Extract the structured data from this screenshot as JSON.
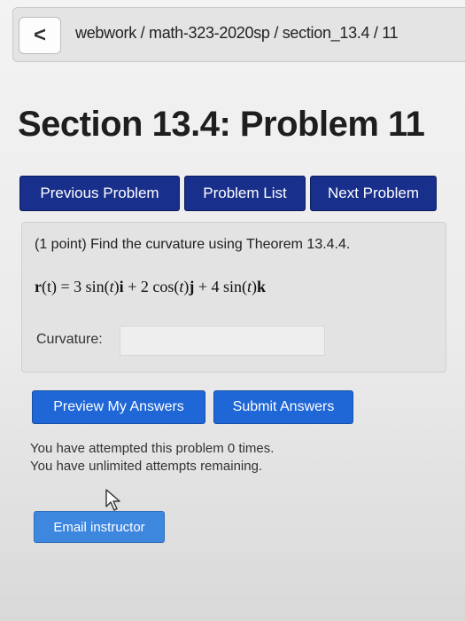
{
  "header": {
    "back_label": "<",
    "breadcrumb": "webwork / math-323-2020sp / section_13.4 / 11"
  },
  "page_title": "Section 13.4: Problem 11",
  "nav": {
    "previous": "Previous Problem",
    "list": "Problem List",
    "next": "Next Problem"
  },
  "problem": {
    "statement": "(1 point) Find the curvature using Theorem 13.4.4.",
    "formula": {
      "lhs_vec": "r",
      "lhs_arg": "(t)",
      "eq": " = 3 sin(",
      "t1": "t",
      "p1": ")",
      "i": "i",
      "p2": " + 2 cos(",
      "t2": "t",
      "p3": ")",
      "j": "j",
      "p4": " + 4 sin(",
      "t3": "t",
      "p5": ")",
      "k": "k"
    },
    "answer_label": "Curvature:",
    "answer_value": ""
  },
  "actions": {
    "preview": "Preview My Answers",
    "submit": "Submit Answers"
  },
  "attempts": {
    "line1": "You have attempted this problem 0 times.",
    "line2": "You have unlimited attempts remaining."
  },
  "email_label": "Email instructor",
  "icons": {
    "back": "chevron-left-icon",
    "cursor": "mouse-pointer-icon"
  },
  "colors": {
    "nav_button": "#182f8c",
    "action_button": "#1f66d6",
    "email_button": "#3d87de"
  }
}
